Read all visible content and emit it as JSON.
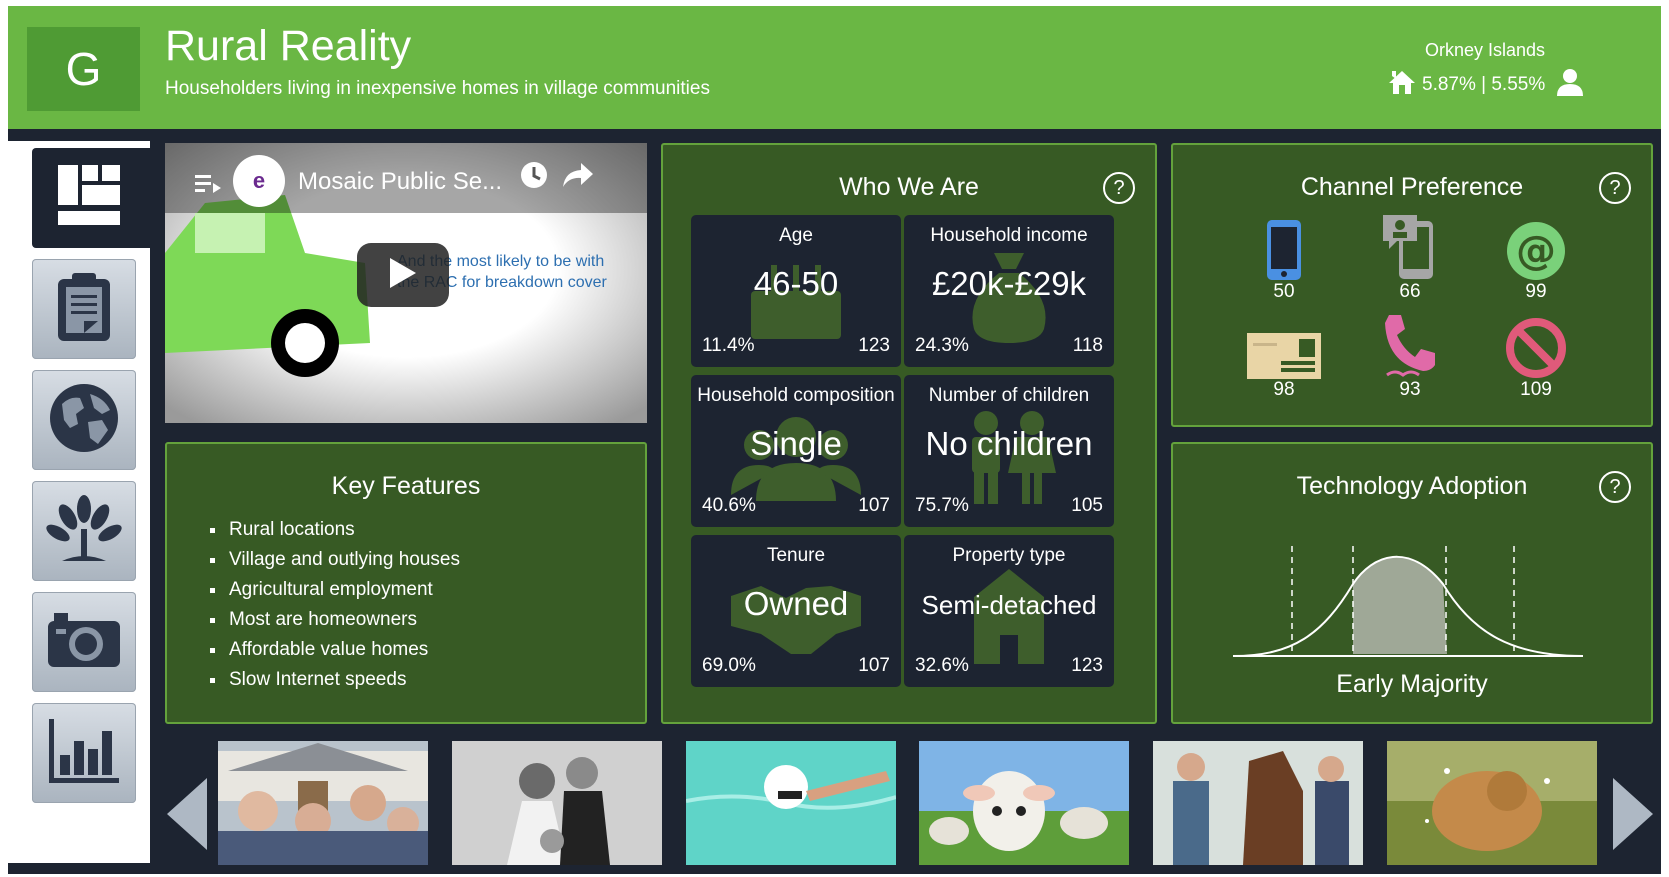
{
  "header": {
    "group_letter": "G",
    "title": "Rural Reality",
    "subtitle": "Householders living in inexpensive homes in village communities",
    "region": "Orkney Islands",
    "stats": "5.87% | 5.55%"
  },
  "video": {
    "title": "Mosaic Public Se...",
    "caption_line1": "And the most likely to be with",
    "caption_line2": "the RAC for breakdown cover"
  },
  "key_features": {
    "title": "Key Features",
    "items": [
      "Rural locations",
      "Village and outlying houses",
      "Agricultural employment",
      "Most are homeowners",
      "Affordable value homes",
      "Slow Internet speeds"
    ]
  },
  "who_we_are": {
    "title": "Who We Are",
    "help": "?",
    "tiles": [
      {
        "label": "Age",
        "value": "46-50",
        "pct": "11.4%",
        "index": "123"
      },
      {
        "label": "Household income",
        "value": "£20k-£29k",
        "pct": "24.3%",
        "index": "118"
      },
      {
        "label": "Household composition",
        "value": "Single",
        "pct": "40.6%",
        "index": "107"
      },
      {
        "label": "Number of children",
        "value": "No children",
        "pct": "75.7%",
        "index": "105"
      },
      {
        "label": "Tenure",
        "value": "Owned",
        "pct": "69.0%",
        "index": "107"
      },
      {
        "label": "Property type",
        "value": "Semi-detached",
        "pct": "32.6%",
        "index": "123"
      }
    ]
  },
  "channel_preference": {
    "title": "Channel Preference",
    "help": "?",
    "channels": [
      {
        "icon": "mobile-phone-icon",
        "value": "50",
        "color": "#4a90e2"
      },
      {
        "icon": "smartphone-message-icon",
        "value": "66",
        "color": "#a6a6a6"
      },
      {
        "icon": "email-at-icon",
        "value": "99",
        "color": "#7ad17a"
      },
      {
        "icon": "mail-envelope-icon",
        "value": "98",
        "color": "#e9d5a6"
      },
      {
        "icon": "telephone-icon",
        "value": "93",
        "color": "#e06aa8"
      },
      {
        "icon": "no-contact-icon",
        "value": "109",
        "color": "#e05a7a"
      }
    ]
  },
  "technology_adoption": {
    "title": "Technology Adoption",
    "help": "?",
    "category": "Early Majority"
  },
  "colors": {
    "header_green": "#6ab744",
    "panel_green": "#375a24",
    "navy": "#1d2431"
  },
  "sidebar": [
    "dashboard-icon",
    "clipboard-icon",
    "globe-icon",
    "tree-icon",
    "camera-icon",
    "bar-chart-icon"
  ]
}
